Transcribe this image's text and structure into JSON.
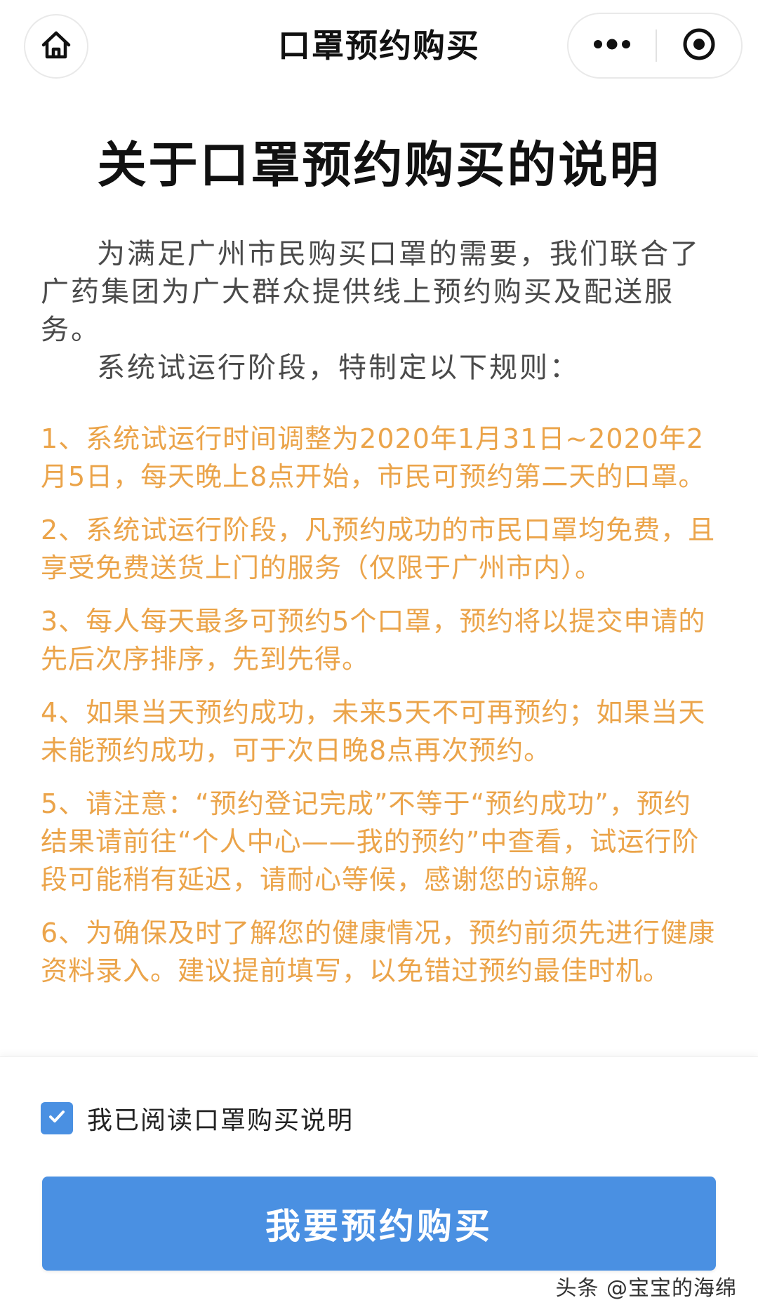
{
  "navbar": {
    "title": "口罩预约购买",
    "home_icon": "home-icon",
    "more_icon": "more-dots-icon",
    "close_icon": "target-icon"
  },
  "document": {
    "title": "关于口罩预约购买的说明",
    "intro": "为满足广州市民购买口罩的需要，我们联合了广药集团为广大群众提供线上预约购买及配送服务。",
    "rules_intro": "系统试运行阶段，特制定以下规则：",
    "rules": [
      "1、系统试运行时间调整为2020年1月31日~2020年2月5日，每天晚上8点开始，市民可预约第二天的口罩。",
      "2、系统试运行阶段，凡预约成功的市民口罩均免费，且享受免费送货上门的服务（仅限于广州市内）。",
      "3、每人每天最多可预约5个口罩，预约将以提交申请的先后次序排序，先到先得。",
      "4、如果当天预约成功，未来5天不可再预约；如果当天未能预约成功，可于次日晚8点再次预约。",
      "5、请注意：“预约登记完成”不等于“预约成功”，预约结果请前往“个人中心——我的预约”中查看，试运行阶段可能稍有延迟，请耐心等候，感谢您的谅解。",
      "6、为确保及时了解您的健康情况，预约前须先进行健康资料录入。建议提前填写，以免错过预约最佳时机。"
    ]
  },
  "footer": {
    "checkbox_label": "我已阅读口罩购买说明",
    "checkbox_checked": true,
    "button_label": "我要预约购买"
  },
  "watermark": "头条 @宝宝的海绵",
  "colors": {
    "accent": "#4a90e2",
    "rule_text": "#eba44a",
    "body_text": "#4a4a4a"
  }
}
